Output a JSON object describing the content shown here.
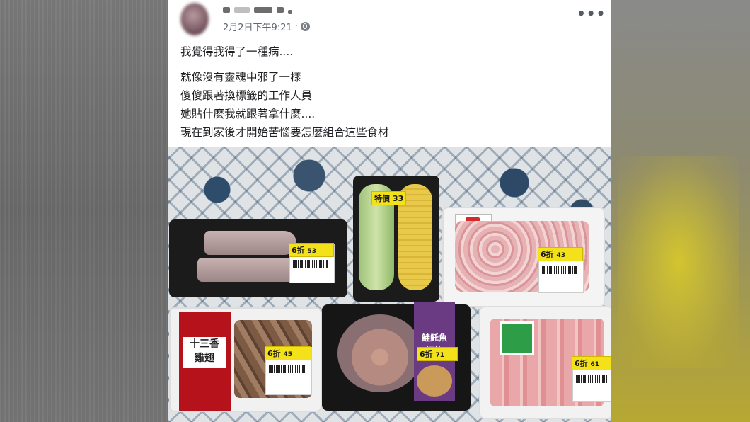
{
  "post": {
    "timestamp": "2月2日下午9:21",
    "separator": "·",
    "privacy_icon": "globe-icon",
    "more_icon": "more-options-icon",
    "more_label": "•••",
    "message_lines": [
      "我覺得我得了一種病....",
      "就像沒有靈魂中邪了一樣",
      "傻傻跟著換標籤的工作人員",
      "她貼什麼我就跟著拿什麼....",
      "現在到家後才開始苦惱要怎麼組合這些食材"
    ]
  },
  "photo": {
    "items": {
      "squid": {
        "discount": "6折",
        "price": "53"
      },
      "corn": {
        "tag": "特價",
        "price": "33"
      },
      "pork": {
        "discount": "6折",
        "price": "43"
      },
      "wings": {
        "pack_text": "十三香\n雞翅",
        "discount": "6折",
        "price": "45"
      },
      "fish": {
        "card_text": "鮭魠魚\n切片",
        "discount": "6折",
        "price": "71"
      },
      "loin": {
        "discount": "6折",
        "price": "61"
      }
    }
  }
}
